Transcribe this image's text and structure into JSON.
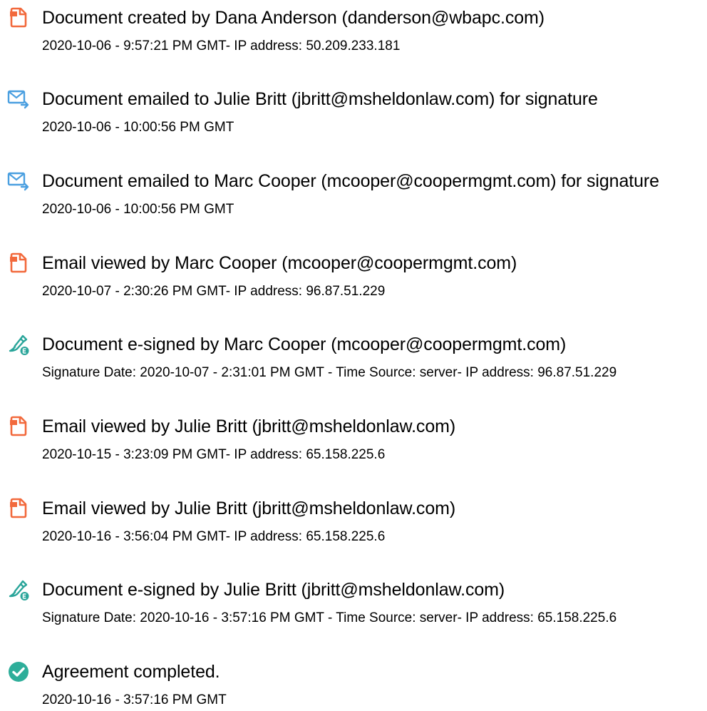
{
  "colors": {
    "document_icon": "#f2693c",
    "email_icon": "#4a9fe0",
    "esign_icon": "#2aa59a",
    "completed_icon": "#2eae9a"
  },
  "events": [
    {
      "icon": "document-icon",
      "title": "Document created by Dana Anderson (danderson@wbapc.com)",
      "detail": "2020-10-06 - 9:57:21 PM GMT- IP address: 50.209.233.181"
    },
    {
      "icon": "email-sent-icon",
      "title": "Document emailed to Julie Britt (jbritt@msheldonlaw.com) for signature",
      "detail": "2020-10-06 - 10:00:56 PM GMT"
    },
    {
      "icon": "email-sent-icon",
      "title": "Document emailed to Marc Cooper (mcooper@coopermgmt.com) for signature",
      "detail": "2020-10-06 - 10:00:56 PM GMT"
    },
    {
      "icon": "document-icon",
      "title": "Email viewed by Marc Cooper (mcooper@coopermgmt.com)",
      "detail": "2020-10-07 - 2:30:26 PM GMT- IP address: 96.87.51.229"
    },
    {
      "icon": "esign-pen-icon",
      "title": "Document e-signed by Marc Cooper (mcooper@coopermgmt.com)",
      "detail": "Signature Date: 2020-10-07 - 2:31:01 PM GMT - Time Source: server- IP address: 96.87.51.229"
    },
    {
      "icon": "document-icon",
      "title": "Email viewed by Julie Britt (jbritt@msheldonlaw.com)",
      "detail": "2020-10-15 - 3:23:09 PM GMT- IP address: 65.158.225.6"
    },
    {
      "icon": "document-icon",
      "title": "Email viewed by Julie Britt (jbritt@msheldonlaw.com)",
      "detail": "2020-10-16 - 3:56:04 PM GMT- IP address: 65.158.225.6"
    },
    {
      "icon": "esign-pen-icon",
      "title": "Document e-signed by Julie Britt (jbritt@msheldonlaw.com)",
      "detail": "Signature Date: 2020-10-16 - 3:57:16 PM GMT - Time Source: server- IP address: 65.158.225.6"
    },
    {
      "icon": "check-circle-icon",
      "title": "Agreement completed.",
      "detail": "2020-10-16 - 3:57:16 PM GMT"
    }
  ]
}
